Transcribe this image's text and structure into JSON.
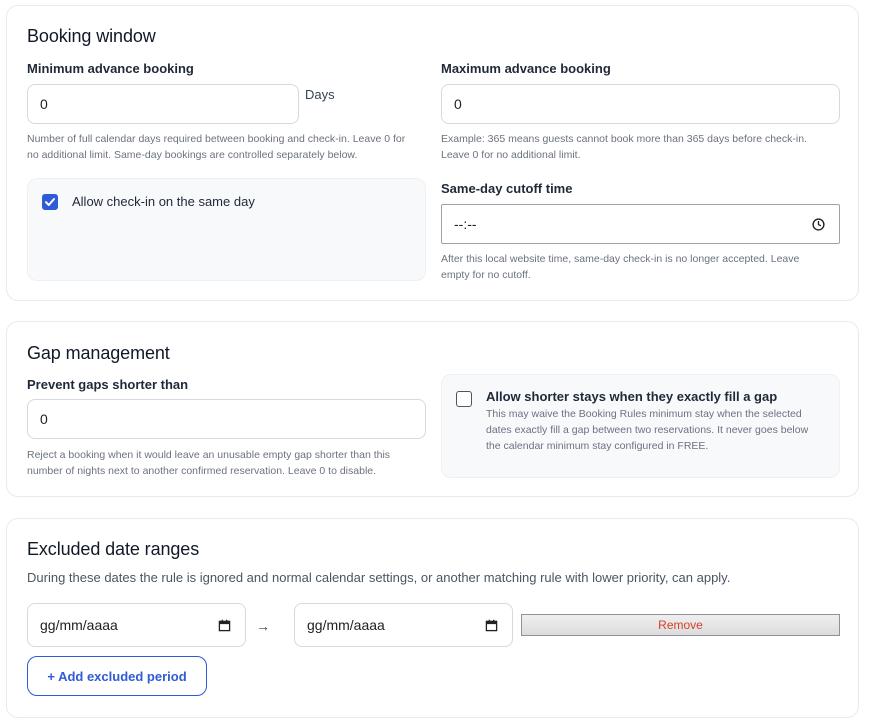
{
  "booking_window": {
    "title": "Booking window",
    "min_label": "Minimum advance booking",
    "min_value": "0",
    "min_unit": "Days",
    "min_help_1": "Number of full calendar days required between booking and check-in. Leave 0 for",
    "min_help_2": "no additional limit. Same-day bookings are controlled separately below.",
    "max_label": "Maximum advance booking",
    "max_value": "0",
    "max_help_1": "Example: 365 means guests cannot book more than 365 days before check-in.",
    "max_help_2": "Leave 0 for no additional limit.",
    "same_day_checkbox_label": "Allow check-in on the same day",
    "same_day_checked": true,
    "cutoff_label": "Same-day cutoff time",
    "cutoff_value": "--:--",
    "cutoff_help_1": "After this local website time, same-day check-in is no longer accepted. Leave",
    "cutoff_help_2": "empty for no cutoff."
  },
  "gap_management": {
    "title": "Gap management",
    "prevent_label": "Prevent gaps shorter than",
    "prevent_value": "0",
    "prevent_help_1": "Reject a booking when it would leave an unusable empty gap shorter than this",
    "prevent_help_2": "number of nights next to another confirmed reservation. Leave 0 to disable.",
    "allow_label": "Allow shorter stays when they exactly fill a gap",
    "allow_checked": false,
    "allow_help_1": "This may waive the Booking Rules minimum stay when the selected",
    "allow_help_2": "dates exactly fill a gap between two reservations. It never goes below",
    "allow_help_3": "the calendar minimum stay configured in FREE."
  },
  "excluded": {
    "title": "Excluded date ranges",
    "description": "During these dates the rule is ignored and normal calendar settings, or another matching rule with lower priority, can apply.",
    "ranges": [
      {
        "start": "gg/mm/aaaa",
        "end": "gg/mm/aaaa"
      }
    ],
    "arrow": "→",
    "remove_label": "Remove",
    "add_label": "+ Add excluded period"
  },
  "colors": {
    "accent": "#2f5bd6",
    "remove_text": "#d6402a",
    "panel_bg": "#f7f9fb"
  },
  "icons": {
    "checkmark": "checkmark-icon",
    "clock": "clock-icon",
    "calendar": "calendar-icon"
  }
}
